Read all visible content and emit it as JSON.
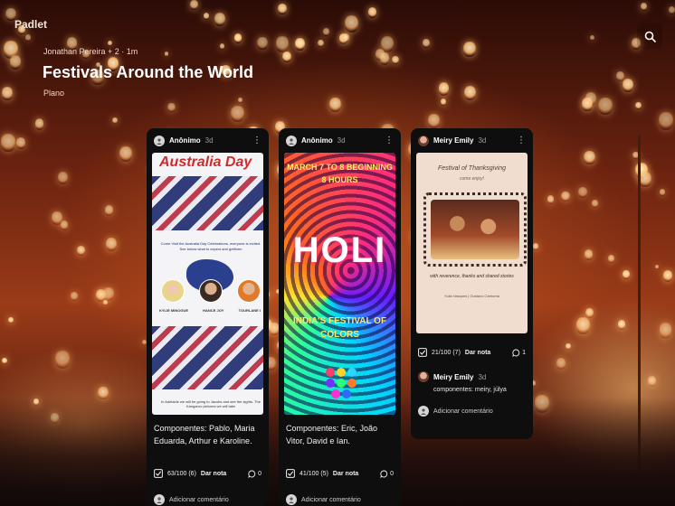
{
  "app": {
    "brand": "Padlet"
  },
  "board": {
    "meta": "Jonathan Pereira + 2 · 1m",
    "title": "Festivals Around the World",
    "subtitle": "Plano"
  },
  "colors": {
    "card_bg": "#0e0e0e",
    "lantern": "#ffc27a",
    "accent_red": "#d12a2a"
  },
  "icons": {
    "search": "search-icon",
    "more": "kebab-icon",
    "rating": "checkbox-icon",
    "comment": "comment-icon"
  },
  "posts": [
    {
      "author": "Anônimo",
      "ago": "3d",
      "poster": {
        "title": "Australia Day",
        "blurb": "Come Visit the Australia Day Celebrations, everyone is invited. See below what to expect and getlform",
        "names": [
          "KYLIE MINOGUE",
          "HANCE JOY",
          "TOURLANE I"
        ],
        "foot": "In Adelaide we will be going to Jacobs and see the sights. The Kangaroo pictures we will take"
      },
      "caption": "Componentes: Pablo, Maria Eduarda, Arthur e Karoline.",
      "rating": "63/100 (6)",
      "rate_label": "Dar nota",
      "comments": "0",
      "add_comment": "Adicionar comentário"
    },
    {
      "author": "Anônimo",
      "ago": "3d",
      "poster": {
        "top": "MARCH 7 TO 8 BEGINNING 8 HOURS",
        "big": "HOLI",
        "bottom": "INDIA'S FESTIVAL OF COLORS"
      },
      "caption": "Componentes: Eric, João Vitor, David e Ian.",
      "rating": "41/100 (5)",
      "rate_label": "Dar nota",
      "comments": "0",
      "add_comment": "Adicionar comentário"
    },
    {
      "author": "Meiry Emily",
      "ago": "3d",
      "poster": {
        "title": "Festival of Thanksgiving",
        "sub": "come enjoy!",
        "quote": "with reverence, thanks and shared stories",
        "foot": "Yulia Vasques | Gustavo Carhoma"
      },
      "rating": "21/100 (7)",
      "rate_label": "Dar nota",
      "comments": "1",
      "reply": {
        "author": "Meiry Emily",
        "ago": "3d",
        "text": "componentes: meiry, júlya"
      },
      "add_comment": "Adicionar comentário"
    }
  ]
}
